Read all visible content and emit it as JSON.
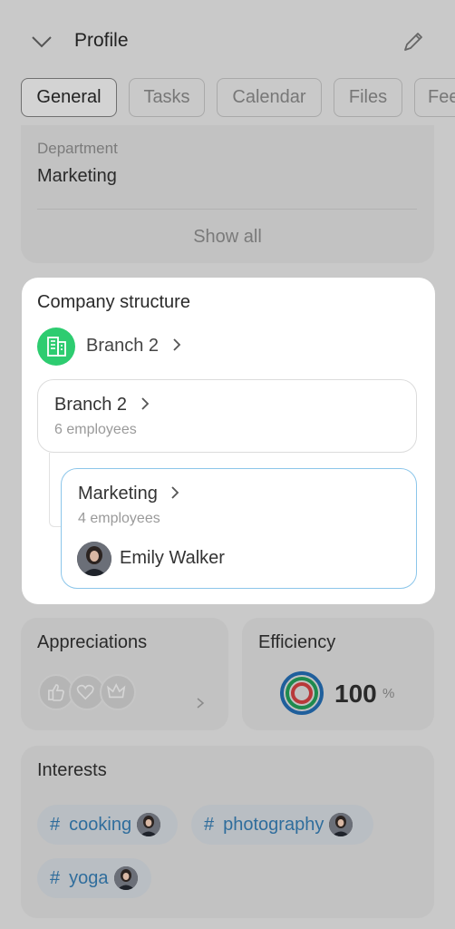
{
  "header": {
    "title": "Profile"
  },
  "tabs": [
    {
      "label": "General",
      "active": true
    },
    {
      "label": "Tasks",
      "active": false
    },
    {
      "label": "Calendar",
      "active": false
    },
    {
      "label": "Files",
      "active": false
    },
    {
      "label": "Fee",
      "active": false
    }
  ],
  "info": {
    "department_label": "Department",
    "department_value": "Marketing",
    "show_all": "Show all"
  },
  "company_structure": {
    "title": "Company structure",
    "branch_link": "Branch 2",
    "branch_card": {
      "name": "Branch 2",
      "count": "6 employees"
    },
    "department_card": {
      "name": "Marketing",
      "count": "4 employees",
      "head": "Emily Walker"
    }
  },
  "appreciations": {
    "title": "Appreciations",
    "badges": [
      "thumbs-up-icon",
      "heart-icon",
      "crown-icon"
    ]
  },
  "efficiency": {
    "title": "Efficiency",
    "value": "100",
    "unit": "%"
  },
  "interests": {
    "title": "Interests",
    "tags": [
      {
        "hash": "#",
        "label": "cooking"
      },
      {
        "hash": "#",
        "label": "photography"
      },
      {
        "hash": "#",
        "label": "yoga"
      }
    ]
  },
  "colors": {
    "accent_green": "#2dcc70",
    "link_blue": "#2f6d9c",
    "highlight_border": "#8cc6ea",
    "overlay": "#c9c9c9"
  }
}
